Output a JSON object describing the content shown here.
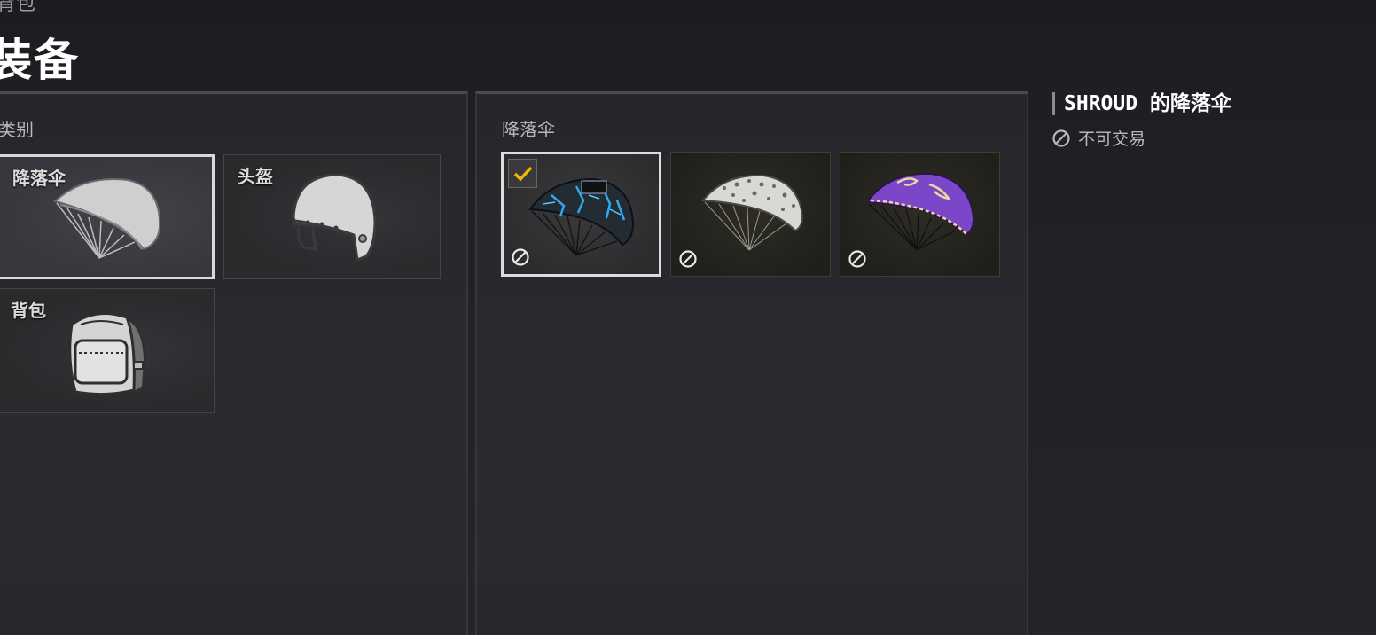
{
  "breadcrumb": "背包",
  "page_title": "装备",
  "categories": {
    "label": "类别",
    "items": [
      {
        "label": "降落伞",
        "icon": "parachute-icon",
        "selected": true
      },
      {
        "label": "头盔",
        "icon": "helmet-icon",
        "selected": false
      },
      {
        "label": "背包",
        "icon": "backpack-icon",
        "selected": false
      }
    ]
  },
  "parachutes": {
    "label": "降落伞",
    "items": [
      {
        "name": "blue-lightning-parachute",
        "selected": true,
        "tradable": false
      },
      {
        "name": "white-pattern-parachute",
        "selected": false,
        "tradable": false
      },
      {
        "name": "purple-dragon-parachute",
        "selected": false,
        "tradable": false
      }
    ]
  },
  "details": {
    "title": "SHROUD 的降落伞",
    "status": "不可交易",
    "status_icon": "not-tradable-icon"
  },
  "colors": {
    "check": "#f2b705",
    "background": "#201f24"
  }
}
